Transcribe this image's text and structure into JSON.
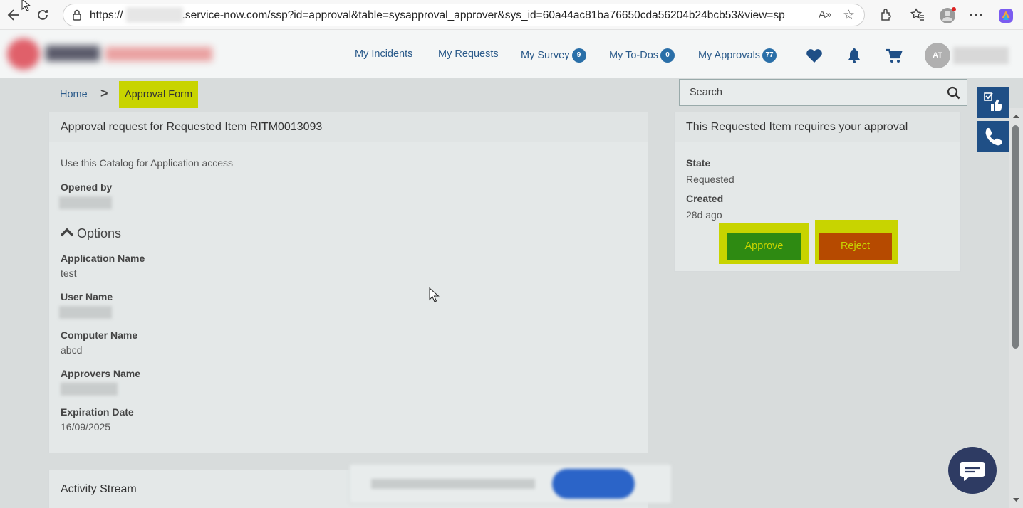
{
  "browser": {
    "url_prefix": "https://",
    "url_rest": ".service-now.com/ssp?id=approval&table=sysapproval_approver&sys_id=60a44ac81ba76650cda56204b24bcb53&view=sp",
    "read_aloud_label": "A»"
  },
  "header": {
    "nav": {
      "incidents": "My Incidents",
      "requests": "My Requests",
      "survey": "My Survey",
      "survey_count": "9",
      "todos": "My To-Dos",
      "todos_count": "0",
      "approvals": "My Approvals",
      "approvals_count": "77"
    },
    "avatar_initials": "AT"
  },
  "breadcrumb": {
    "home": "Home",
    "separator": ">",
    "current": "Approval Form"
  },
  "search": {
    "placeholder": "Search"
  },
  "request_panel": {
    "title": "Approval request for Requested Item RITM0013093",
    "description": "Use this Catalog for Application access",
    "opened_by_label": "Opened by",
    "options_label": "Options",
    "fields": {
      "app_name_label": "Application Name",
      "app_name_value": "test",
      "user_name_label": "User Name",
      "computer_name_label": "Computer Name",
      "computer_name_value": "abcd",
      "approvers_name_label": "Approvers Name",
      "expiration_date_label": "Expiration Date",
      "expiration_date_value": "16/09/2025"
    }
  },
  "approval_panel": {
    "title": "This Requested Item requires your approval",
    "state_label": "State",
    "state_value": "Requested",
    "created_label": "Created",
    "created_value": "28d ago",
    "approve_label": "Approve",
    "reject_label": "Reject"
  },
  "activity": {
    "title": "Activity Stream"
  },
  "colors": {
    "highlight": "#c8d400",
    "approve": "#2e8a12",
    "reject": "#b64a00",
    "brand_blue": "#1f4f86"
  }
}
